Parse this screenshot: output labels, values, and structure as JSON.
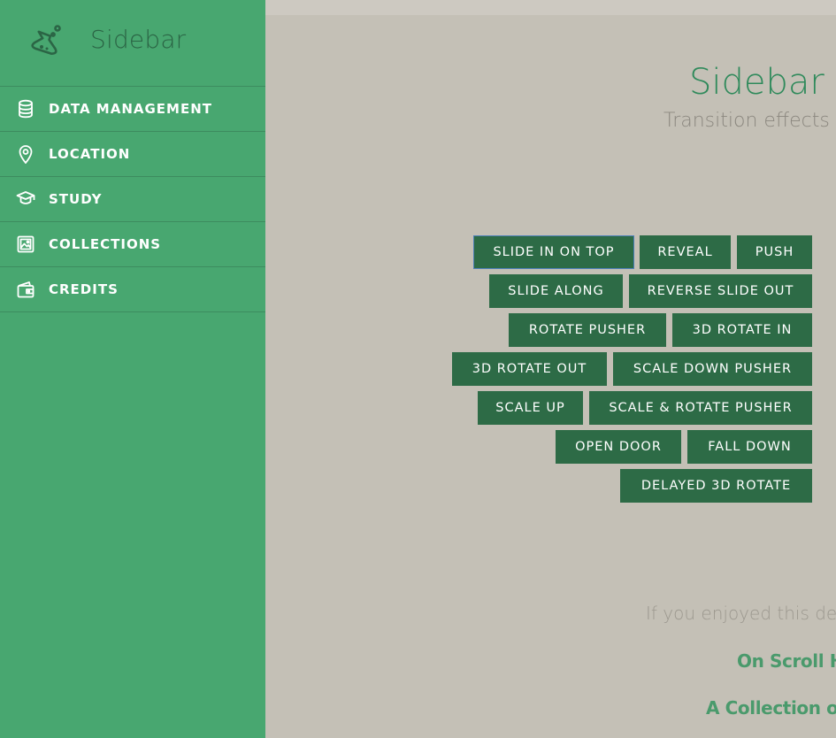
{
  "sidebar": {
    "title": "Sidebar",
    "items": [
      {
        "label": "DATA MANAGEMENT",
        "icon": "database-icon"
      },
      {
        "label": "LOCATION",
        "icon": "map-pin-icon"
      },
      {
        "label": "STUDY",
        "icon": "graduation-cap-icon"
      },
      {
        "label": "COLLECTIONS",
        "icon": "image-gallery-icon"
      },
      {
        "label": "CREDITS",
        "icon": "wallet-icon"
      }
    ]
  },
  "main": {
    "title": "Sidebar T",
    "subtitle": "Transition effects f",
    "buttons": [
      "SLIDE IN ON TOP",
      "REVEAL",
      "PUSH",
      "SLIDE ALONG",
      "REVERSE SLIDE OUT",
      "ROTATE PUSHER",
      "3D ROTATE IN",
      "3D ROTATE OUT",
      "SCALE DOWN PUSHER",
      "SCALE UP",
      "SCALE & ROTATE PUSHER",
      "OPEN DOOR",
      "FALL DOWN",
      "DELAYED 3D ROTATE"
    ],
    "footer_text": "If you enjoyed this de",
    "links": [
      "On Scroll He",
      "A Collection of"
    ]
  },
  "colors": {
    "sidebar_bg": "#48a770",
    "page_bg": "#c4c0b6",
    "button_bg": "#2d6b46",
    "accent": "#2f8a5b"
  }
}
